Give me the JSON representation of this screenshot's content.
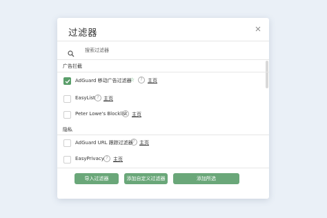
{
  "dialog": {
    "title": "过滤器",
    "search_placeholder": "搜索过滤器"
  },
  "sections": [
    {
      "label": "广告拦截",
      "items": [
        {
          "name": "AdGuard 移动广告过滤器",
          "checked": true,
          "trusted": true,
          "home": "主页"
        },
        {
          "name": "EasyList",
          "checked": false,
          "home": "主页"
        },
        {
          "name": "Peter Lowe's Blocklist",
          "checked": false,
          "home": "主页"
        }
      ]
    },
    {
      "label": "隐私",
      "items": [
        {
          "name": "AdGuard URL 跟踪过滤器",
          "checked": false,
          "home": "主页"
        },
        {
          "name": "EasyPrivacy",
          "checked": false,
          "home": "主页"
        }
      ]
    }
  ],
  "footer": {
    "import_label": "导入过滤器",
    "custom_label": "添加自定义过滤器",
    "add_selected_label": "添加所选"
  },
  "colors": {
    "accent": "#6aa779",
    "checkbox_checked": "#5a9e6a",
    "background": "#eaf0f7"
  },
  "icons": {
    "search": "search-icon",
    "close": "close-icon",
    "star": "star-icon",
    "help": "question-circle-icon"
  }
}
